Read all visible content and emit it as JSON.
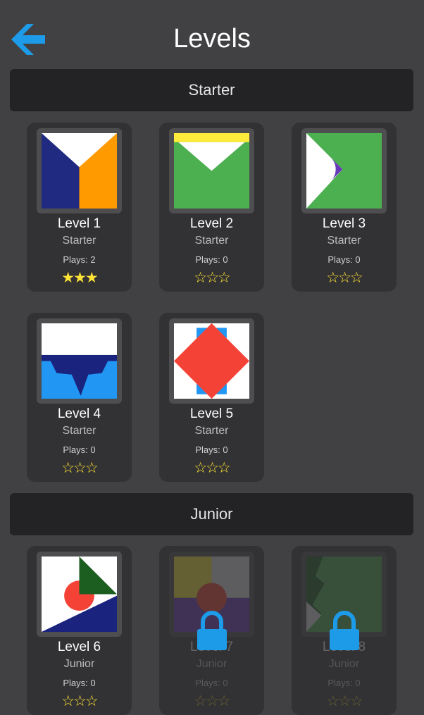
{
  "header": {
    "title": "Levels",
    "back_icon": "back-arrow-icon"
  },
  "colors": {
    "accent": "#1e9be8",
    "background": "#414042",
    "card": "#323133",
    "bar": "#232224",
    "star": "#ffe437"
  },
  "sections": [
    {
      "label": "Starter",
      "levels": [
        {
          "name": "Level 1",
          "category": "Starter",
          "plays": "Plays: 2",
          "stars_earned": 3,
          "stars_total": 3,
          "locked": false
        },
        {
          "name": "Level 2",
          "category": "Starter",
          "plays": "Plays: 0",
          "stars_earned": 0,
          "stars_total": 3,
          "locked": false
        },
        {
          "name": "Level 3",
          "category": "Starter",
          "plays": "Plays: 0",
          "stars_earned": 0,
          "stars_total": 3,
          "locked": false
        },
        {
          "name": "Level 4",
          "category": "Starter",
          "plays": "Plays: 0",
          "stars_earned": 0,
          "stars_total": 3,
          "locked": false
        },
        {
          "name": "Level 5",
          "category": "Starter",
          "plays": "Plays: 0",
          "stars_earned": 0,
          "stars_total": 3,
          "locked": false
        }
      ]
    },
    {
      "label": "Junior",
      "levels": [
        {
          "name": "Level 6",
          "category": "Junior",
          "plays": "Plays: 0",
          "stars_earned": 0,
          "stars_total": 3,
          "locked": false
        },
        {
          "name": "Level 7",
          "category": "Junior",
          "plays": "Plays: 0",
          "stars_earned": 0,
          "stars_total": 3,
          "locked": true
        },
        {
          "name": "Level 8",
          "category": "Junior",
          "plays": "Plays: 0",
          "stars_earned": 0,
          "stars_total": 3,
          "locked": true
        }
      ]
    }
  ]
}
